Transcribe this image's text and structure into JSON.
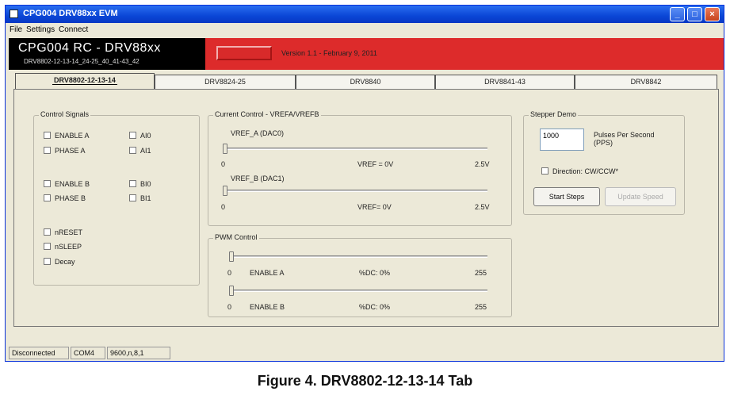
{
  "window": {
    "title": "CPG004 DRV88xx EVM"
  },
  "menu": {
    "file": "File",
    "settings": "Settings",
    "connect": "Connect"
  },
  "header": {
    "app_name": "CPG004 RC - DRV88xx",
    "subtitle": "DRV8802-12-13-14_24-25_40_41-43_42",
    "version": "Version 1.1 - February 9, 2011"
  },
  "tabs": [
    {
      "label": "DRV8802-12-13-14",
      "active": true
    },
    {
      "label": "DRV8824-25"
    },
    {
      "label": "DRV8840"
    },
    {
      "label": "DRV8841-43"
    },
    {
      "label": "DRV8842"
    }
  ],
  "control_signals": {
    "title": "Control Signals",
    "enable_a": "ENABLE A",
    "phase_a": "PHASE A",
    "ai0": "AI0",
    "ai1": "AI1",
    "enable_b": "ENABLE B",
    "phase_b": "PHASE B",
    "bi0": "BI0",
    "bi1": "BI1",
    "nreset": "nRESET",
    "nsleep": "nSLEEP",
    "decay": "Decay"
  },
  "current_control": {
    "title": "Current Control - VREFA/VREFB",
    "vref_a_label": "VREF_A (DAC0)",
    "vref_a_min": "0",
    "vref_a_readout": "VREF = 0V",
    "vref_a_max": "2.5V",
    "vref_a_level": 0,
    "vref_b_label": "VREF_B (DAC1)",
    "vref_b_min": "0",
    "vref_b_readout": "VREF= 0V",
    "vref_b_max": "2.5V",
    "vref_b_level": 0
  },
  "pwm_control": {
    "title": "PWM Control",
    "a_min": "0",
    "a_label": "ENABLE A",
    "a_dc": "%DC: 0%",
    "a_max": "255",
    "a_level": 0,
    "b_min": "0",
    "b_label": "ENABLE B",
    "b_dc": "%DC: 0%",
    "b_max": "255",
    "b_level": 0
  },
  "stepper_demo": {
    "title": "Stepper Demo",
    "pps_value": "1000",
    "pps_label_1": "Pulses Per Second",
    "pps_label_2": "(PPS)",
    "direction_label": "Direction: CW/CCW*",
    "start_button": "Start Steps",
    "update_button": "Update Speed"
  },
  "status": {
    "connection": "Disconnected",
    "port": "COM4",
    "settings": "9600,n,8,1"
  },
  "caption": "Figure 4. DRV8802-12-13-14 Tab",
  "colors": {
    "banner_red": "#dd2b2b",
    "banner_black": "#000000",
    "titlebar_blue": "#0a46d6"
  }
}
